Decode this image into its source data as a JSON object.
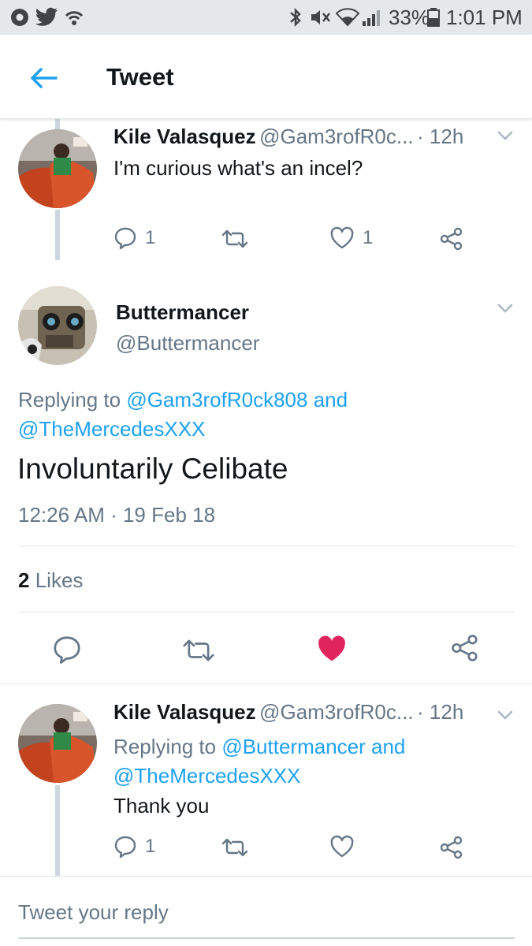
{
  "status_bar": {
    "battery": "33%",
    "time": "1:01 PM"
  },
  "header": {
    "title": "Tweet"
  },
  "tweet1": {
    "name": "Kile Valasquez",
    "handle": "@Gam3rofR0c...",
    "time": "· 12h",
    "text": "I'm curious what's an incel?",
    "reply_count": "1",
    "like_count": "1"
  },
  "main_tweet": {
    "name": "Buttermancer",
    "handle": "@Buttermancer",
    "replying_prefix": "Replying to",
    "replying_user1": "@Gam3rofR0ck808",
    "replying_and": "and",
    "replying_user2": "@TheMercedesXXX",
    "text": "Involuntarily Celibate",
    "timestamp": "12:26 AM · 19 Feb 18",
    "likes_count": "2",
    "likes_label": "Likes"
  },
  "tweet3": {
    "name": "Kile Valasquez",
    "handle": "@Gam3rofR0c...",
    "time": "· 12h",
    "replying_prefix": "Replying to",
    "replying_user1": "@Buttermancer",
    "replying_and": "and",
    "replying_user2": "@TheMercedesXXX",
    "text": "Thank you",
    "reply_count": "1"
  },
  "composer": {
    "placeholder": "Tweet your reply"
  },
  "colors": {
    "accent": "#1da1f2",
    "like": "#e0245e",
    "muted": "#657786"
  }
}
